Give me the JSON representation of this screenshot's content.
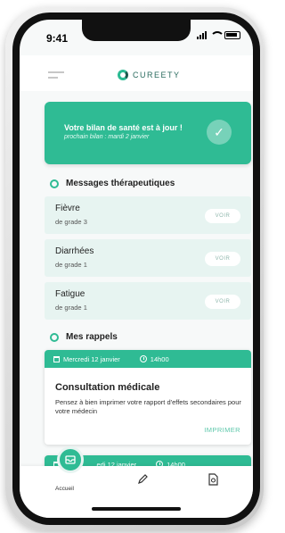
{
  "status": {
    "time": "9:41"
  },
  "header": {
    "brand": "CUREETY"
  },
  "banner": {
    "title": "Votre bilan de santé est à jour !",
    "subtitle": "prochain bilan : mardi 2 janvier"
  },
  "messages": {
    "title": "Messages thérapeutiques",
    "items": [
      {
        "name": "Fièvre",
        "grade": "de grade 3",
        "action": "VOIR"
      },
      {
        "name": "Diarrhées",
        "grade": "de grade 1",
        "action": "VOIR"
      },
      {
        "name": "Fatigue",
        "grade": "de grade 1",
        "action": "VOIR"
      }
    ]
  },
  "reminders": {
    "title": "Mes rappels",
    "items": [
      {
        "date": "Mercredi 12 janvier",
        "time": "14h00",
        "title": "Consultation médicale",
        "description": "Pensez à bien imprimer votre rapport d'effets secondaires pour votre médecin",
        "action": "IMPRIMER"
      },
      {
        "date": "…edi 12 janvier",
        "time": "14h00"
      }
    ]
  },
  "tabbar": {
    "home_label": "Accueil"
  },
  "colors": {
    "accent": "#2fbb94",
    "card_bg": "#e7f4f1"
  }
}
